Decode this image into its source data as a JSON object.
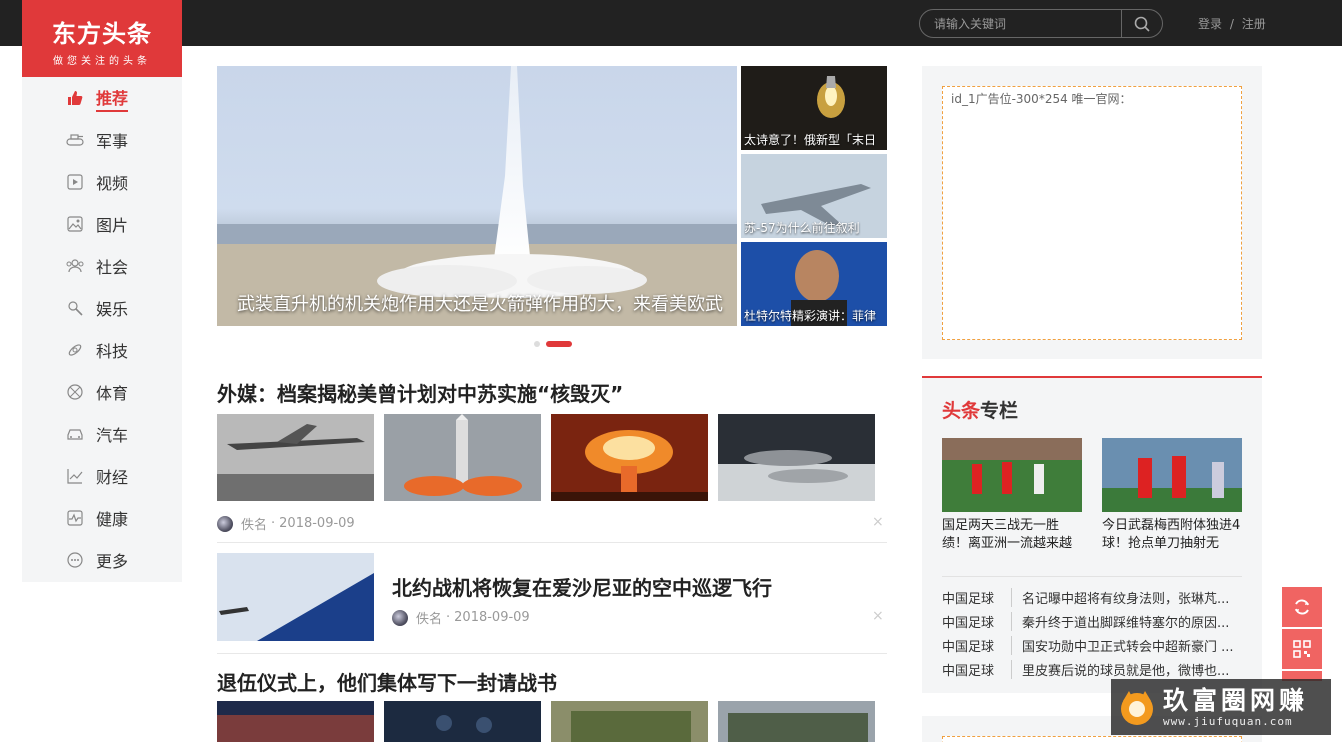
{
  "header": {
    "logo_title": "东方头条",
    "logo_slogan": "做您关注的头条",
    "search_placeholder": "请输入关键词",
    "login": "登录",
    "separator": "/",
    "register": "注册"
  },
  "nav": {
    "items": [
      {
        "label": "推荐",
        "icon": "thumbs-up-icon",
        "active": true
      },
      {
        "label": "军事",
        "icon": "tank-icon"
      },
      {
        "label": "视频",
        "icon": "play-icon"
      },
      {
        "label": "图片",
        "icon": "image-icon"
      },
      {
        "label": "社会",
        "icon": "people-icon"
      },
      {
        "label": "娱乐",
        "icon": "microphone-icon"
      },
      {
        "label": "科技",
        "icon": "tech-icon"
      },
      {
        "label": "体育",
        "icon": "ball-icon"
      },
      {
        "label": "汽车",
        "icon": "car-icon"
      },
      {
        "label": "财经",
        "icon": "chart-icon"
      },
      {
        "label": "健康",
        "icon": "heartbeat-icon"
      },
      {
        "label": "更多",
        "icon": "more-icon"
      }
    ]
  },
  "slider": {
    "main_caption": "武装直升机的机关炮作用大还是火箭弹作用的大，来看美欧武",
    "side": [
      {
        "caption": "太诗意了！俄新型「末日"
      },
      {
        "caption": "苏-57为什么前往叙利"
      },
      {
        "caption": "杜特尔特精彩演讲：菲律"
      }
    ]
  },
  "articles": [
    {
      "title": "外媒：档案揭秘美曾计划对中苏实施“核毁灭”",
      "author": "佚名",
      "date": "2018-09-09"
    },
    {
      "title": "北约战机将恢复在爱沙尼亚的空中巡逻飞行",
      "author": "佚名",
      "date": "2018-09-09"
    },
    {
      "title": "退伍仪式上，他们集体写下一封请战书"
    }
  ],
  "meta_sep": "·",
  "close_mark": "×",
  "ad": {
    "label": "id_1广告位-300*254 唯一官网："
  },
  "column": {
    "title_red": "头条",
    "title_dark": "专栏",
    "cards": [
      {
        "text": "国足两天三战无一胜绩！离亚洲一流越来越"
      },
      {
        "text": "今日武磊梅西附体独进4球！抢点单刀抽射无"
      }
    ],
    "list": [
      {
        "category": "中国足球",
        "title": "名记曝中超将有纹身法则，张琳芃..."
      },
      {
        "category": "中国足球",
        "title": "秦升终于道出脚踩维特塞尔的原因..."
      },
      {
        "category": "中国足球",
        "title": "国安功勋中卫正式转会中超新豪门 ..."
      },
      {
        "category": "中国足球",
        "title": "里皮赛后说的球员就是他，微博也..."
      }
    ]
  },
  "watermark": {
    "name": "玖富圈网赚",
    "url": "www.jiufuquan.com"
  },
  "colors": {
    "brand_red": "#e0393a",
    "topbar": "#222222",
    "nav_bg": "#f4f5f6"
  }
}
